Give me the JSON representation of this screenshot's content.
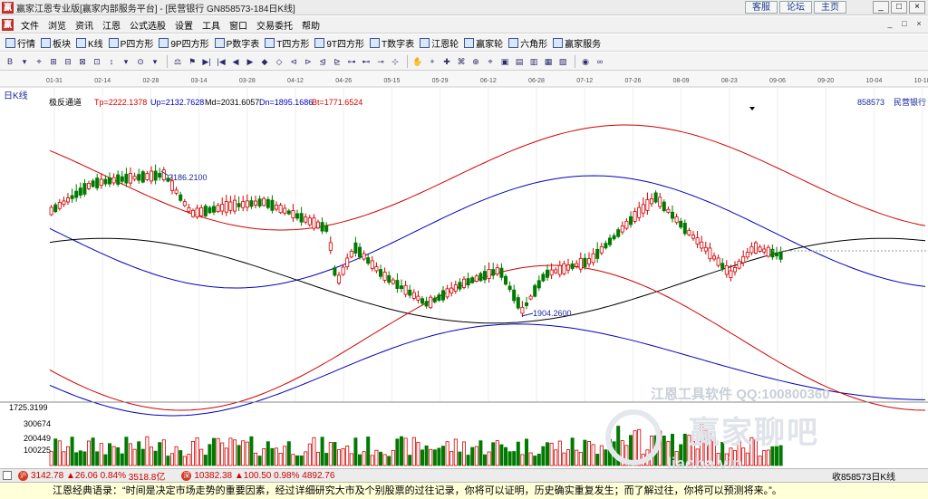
{
  "titlebar": {
    "title": "赢家江恩专业版[赢家内部服务平台] - [民营银行  GN858573-184日K线]",
    "links": [
      "客服",
      "论坛",
      "主页"
    ],
    "buttons": [
      "_",
      "□",
      "×"
    ]
  },
  "menu": {
    "items": [
      "文件",
      "浏览",
      "资讯",
      "江恩",
      "公式选股",
      "设置",
      "工具",
      "窗口",
      "交易委托",
      "帮助"
    ],
    "mdi_buttons": [
      "_",
      "□",
      "×"
    ]
  },
  "toolbar1": {
    "items": [
      {
        "icon": "grid-icon",
        "label": "行情"
      },
      {
        "icon": "blocks-icon",
        "label": "板块"
      },
      {
        "icon": "candle-icon",
        "label": "K线"
      },
      {
        "icon": "p-square-icon",
        "label": "P四方形"
      },
      {
        "icon": "9p-square-icon",
        "label": "9P四方形"
      },
      {
        "icon": "p-table-icon",
        "label": "P数字表"
      },
      {
        "icon": "t-square-icon",
        "label": "T四方形"
      },
      {
        "icon": "9t-square-icon",
        "label": "9T四方形"
      },
      {
        "icon": "t-table-icon",
        "label": "T数字表"
      },
      {
        "icon": "wheel-icon",
        "label": "江恩轮"
      },
      {
        "icon": "winner-wheel-icon",
        "label": "赢家轮"
      },
      {
        "icon": "hexagon-icon",
        "label": "六角形"
      },
      {
        "icon": "dollar-icon",
        "label": "赢家服务"
      }
    ]
  },
  "toolbar2": {
    "groups": [
      [
        "B",
        "▾",
        "⌖",
        "⊞",
        "⊟",
        "⊠",
        "⊡",
        "↕",
        "▾",
        "⊙",
        "▾"
      ],
      [
        "⚖",
        "⚑",
        "▶|",
        "|◀",
        "◀",
        "▶",
        "◆",
        "◇",
        "⊲",
        "⊳",
        "⊴",
        "⊵",
        "⊶",
        "⊷",
        "⊸",
        "⊹"
      ],
      [
        "✋",
        "+",
        "✚",
        "⌘",
        "⊕",
        "⌖",
        "▣",
        "▤",
        "▥",
        "▦",
        "▧"
      ],
      [
        "◉",
        "∞"
      ]
    ]
  },
  "chart": {
    "period_label": "日K线",
    "indicator": {
      "name": "极反通道",
      "tp": "Tp=2222.1378",
      "up": "Up=2132.7628",
      "md": "Md=2031.6057",
      "dn": "Dn=1895.1686",
      "bt": "Bt=1771.6524"
    },
    "stock": {
      "code": "858573",
      "name": "民营银行"
    },
    "date_ticks": [
      "01-31",
      "02-14",
      "02-28",
      "03-14",
      "03-28",
      "04-12",
      "04-26",
      "05-15",
      "05-29",
      "06-12",
      "06-28",
      "07-12",
      "07-26",
      "08-09",
      "08-23",
      "09-06",
      "09-20",
      "10-04",
      "10-18"
    ],
    "annotations": {
      "high": "2186.2100",
      "low": "1904.2600"
    },
    "volume_axis": [
      "1725.3199",
      "300674",
      "200449",
      "100225"
    ],
    "colors": {
      "up": "#d40000",
      "down": "#007a00",
      "outer_band": "#d40000",
      "inner_band": "#0000c0",
      "mid": "#000000",
      "price_label": "#1a2a9a"
    }
  },
  "watermark": {
    "line1": "江恩工具软件",
    "line2": "QQ:100800360",
    "big": "赢家聊吧",
    "domain": "liaoba.vip"
  },
  "statusbar": {
    "indices": [
      {
        "value": "3142.78",
        "change": "▲26.06",
        "pct": "0.84%",
        "amount": "3518.8亿"
      },
      {
        "value": "10382.38",
        "change": "▲100.50",
        "pct": "0.98%",
        "amount": "4892.76"
      }
    ],
    "right_label": "收858573日K线"
  },
  "ticker": {
    "text": "江恩经典语录：“时间是决定市场走势的重要因素，经过详细研究大市及个别股票的过往记录，你将可以证明，历史确实重复发生；而了解过往，你将可以预测将来。”。"
  }
}
